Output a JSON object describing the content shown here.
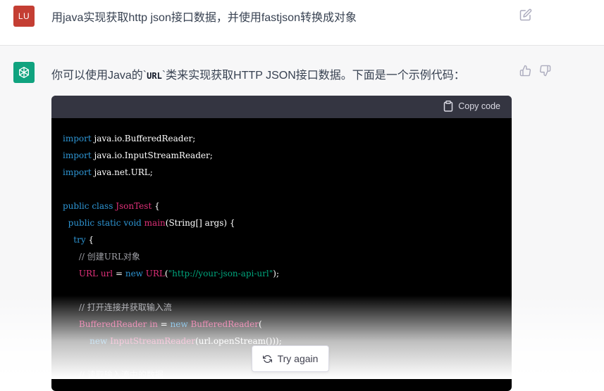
{
  "user": {
    "avatar_initials": "LU",
    "message": "用java实现获取http json接口数据，并使用fastjson转换成对象"
  },
  "assistant": {
    "intro_before": "你可以使用Java的`",
    "intro_code": "URL",
    "intro_after": "`类来实现获取HTTP JSON接口数据。下面是一个示例代码："
  },
  "code": {
    "copy_label": "Copy code",
    "lines": [
      [
        {
          "t": "import",
          "c": "kw"
        },
        {
          "t": " java.io.BufferedReader;",
          "c": ""
        }
      ],
      [
        {
          "t": "import",
          "c": "kw"
        },
        {
          "t": " java.io.InputStreamReader;",
          "c": ""
        }
      ],
      [
        {
          "t": "import",
          "c": "kw"
        },
        {
          "t": " java.net.URL;",
          "c": ""
        }
      ],
      [],
      [
        {
          "t": "public",
          "c": "kw"
        },
        {
          "t": " ",
          "c": ""
        },
        {
          "t": "class",
          "c": "kw"
        },
        {
          "t": " ",
          "c": ""
        },
        {
          "t": "JsonTest",
          "c": "ty"
        },
        {
          "t": " {",
          "c": ""
        }
      ],
      [
        {
          "t": "  ",
          "c": ""
        },
        {
          "t": "public",
          "c": "kw"
        },
        {
          "t": " ",
          "c": ""
        },
        {
          "t": "static",
          "c": "kw"
        },
        {
          "t": " ",
          "c": ""
        },
        {
          "t": "void",
          "c": "kw"
        },
        {
          "t": " ",
          "c": ""
        },
        {
          "t": "main",
          "c": "ty"
        },
        {
          "t": "(String[] args) {",
          "c": ""
        }
      ],
      [
        {
          "t": "    ",
          "c": ""
        },
        {
          "t": "try",
          "c": "kw"
        },
        {
          "t": " {",
          "c": ""
        }
      ],
      [
        {
          "t": "      ",
          "c": ""
        },
        {
          "t": "// 创建URL对象",
          "c": "cm"
        }
      ],
      [
        {
          "t": "      ",
          "c": ""
        },
        {
          "t": "URL",
          "c": "ty"
        },
        {
          "t": " ",
          "c": ""
        },
        {
          "t": "url",
          "c": "ty"
        },
        {
          "t": " = ",
          "c": ""
        },
        {
          "t": "new",
          "c": "kw"
        },
        {
          "t": " ",
          "c": ""
        },
        {
          "t": "URL",
          "c": "ty"
        },
        {
          "t": "(",
          "c": ""
        },
        {
          "t": "\"http://your-json-api-url\"",
          "c": "str"
        },
        {
          "t": ");",
          "c": ""
        }
      ],
      [],
      [
        {
          "t": "      ",
          "c": ""
        },
        {
          "t": "// 打开连接并获取输入流",
          "c": "cm"
        }
      ],
      [
        {
          "t": "      ",
          "c": ""
        },
        {
          "t": "BufferedReader",
          "c": "ty"
        },
        {
          "t": " ",
          "c": ""
        },
        {
          "t": "in",
          "c": "ty"
        },
        {
          "t": " = ",
          "c": ""
        },
        {
          "t": "new",
          "c": "kw"
        },
        {
          "t": " ",
          "c": ""
        },
        {
          "t": "BufferedReader",
          "c": "ty"
        },
        {
          "t": "(",
          "c": ""
        }
      ],
      [
        {
          "t": "          ",
          "c": ""
        },
        {
          "t": "new",
          "c": "kw"
        },
        {
          "t": " ",
          "c": ""
        },
        {
          "t": "InputStreamReader",
          "c": "ty"
        },
        {
          "t": "(url.openStream()));",
          "c": ""
        }
      ],
      [],
      [
        {
          "t": "      ",
          "c": ""
        },
        {
          "t": "// 读取输入流中的数据",
          "c": "cm"
        }
      ]
    ]
  },
  "try_again_label": "Try again",
  "colors": {
    "user_avatar": "#c43e33",
    "assistant_avatar": "#10a37f",
    "keyword": "#2e95d3",
    "type": "#df3079",
    "string": "#00a67d",
    "comment": "#a0a1a7"
  },
  "icons": {
    "edit": "pencil-square-icon",
    "thumbs_up": "thumbs-up-icon",
    "thumbs_down": "thumbs-down-icon",
    "copy": "clipboard-icon",
    "retry": "refresh-icon",
    "assistant_logo": "openai-logo-icon"
  }
}
